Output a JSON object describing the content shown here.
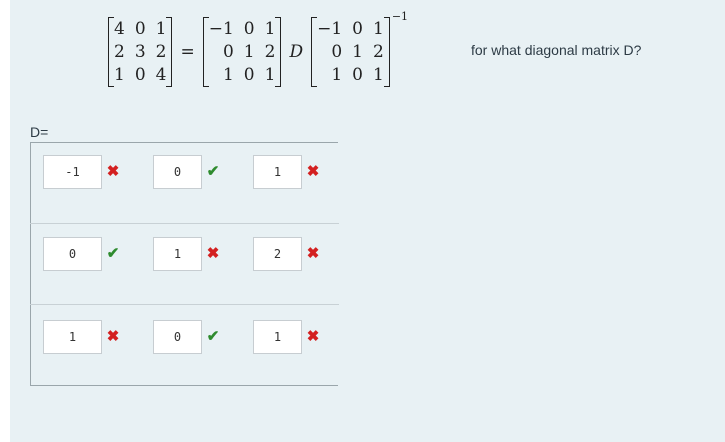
{
  "equation": {
    "lhs": [
      [
        "4",
        "0",
        "1"
      ],
      [
        "2",
        "3",
        "2"
      ],
      [
        "1",
        "0",
        "4"
      ]
    ],
    "equals": "=",
    "p": [
      [
        "−1",
        "0",
        "1"
      ],
      [
        "0",
        "1",
        "2"
      ],
      [
        "1",
        "0",
        "1"
      ]
    ],
    "d_symbol": "D",
    "p_inv": [
      [
        "−1",
        "0",
        "1"
      ],
      [
        "0",
        "1",
        "2"
      ],
      [
        "1",
        "0",
        "1"
      ]
    ],
    "exponent": "−1"
  },
  "question": "for what diagonal matrix D?",
  "answer_label": "D=",
  "answers": [
    [
      {
        "value": "-1",
        "status": "incorrect"
      },
      {
        "value": "0",
        "status": "correct"
      },
      {
        "value": "1",
        "status": "incorrect"
      }
    ],
    [
      {
        "value": "0",
        "status": "correct"
      },
      {
        "value": "1",
        "status": "incorrect"
      },
      {
        "value": "2",
        "status": "incorrect"
      }
    ],
    [
      {
        "value": "1",
        "status": "incorrect"
      },
      {
        "value": "0",
        "status": "correct"
      },
      {
        "value": "1",
        "status": "incorrect"
      }
    ]
  ],
  "marks": {
    "correct": "✔",
    "incorrect": "✖"
  },
  "colors": {
    "panel": "#e8f1f4",
    "correct": "#2e8b2e",
    "incorrect": "#d32020"
  }
}
